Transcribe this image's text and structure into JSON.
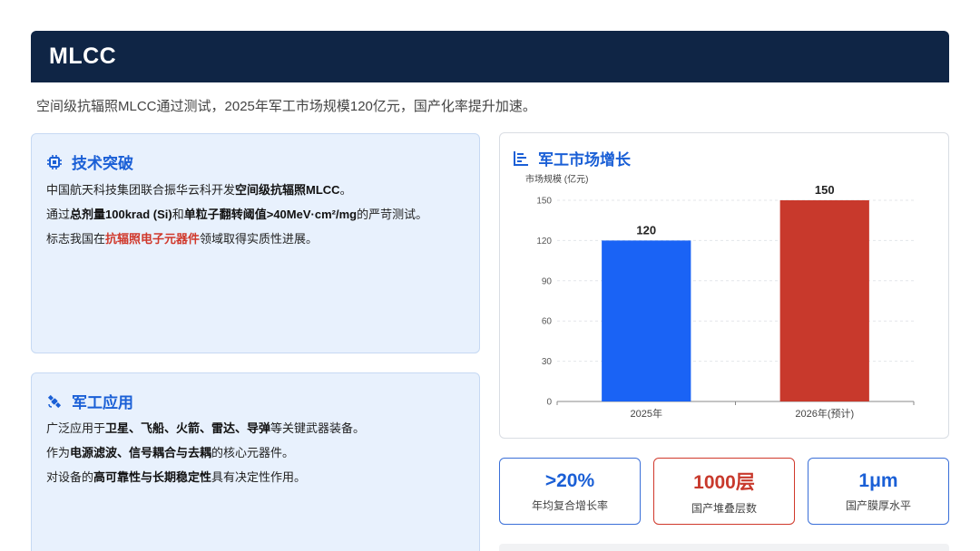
{
  "header": {
    "title": "MLCC"
  },
  "subtitle": "空间级抗辐照MLCC通过测试，2025年军工市场规模120亿元，国产化率提升加速。",
  "tech_card": {
    "title": "技术突破",
    "icon": "chip-icon",
    "line1": {
      "pre": "中国航天科技集团联合振华云科开发",
      "bold": "空间级抗辐照MLCC",
      "post": "。"
    },
    "line2": {
      "pre": "通过",
      "bold1": "总剂量100krad (Si)",
      "mid": "和",
      "bold2": "单粒子翻转阈值>40MeV·cm²/mg",
      "post": "的严苛测试。"
    },
    "line3": {
      "pre": "标志我国在",
      "red": "抗辐照电子元器件",
      "post": "领域取得实质性进展。"
    }
  },
  "mil_card": {
    "title": "军工应用",
    "icon": "satellite-icon",
    "line1": {
      "pre": "广泛应用于",
      "bold": "卫星、飞船、火箭、雷达、导弹",
      "post": "等关键武器装备。"
    },
    "line2": {
      "pre": "作为",
      "bold": "电源滤波、信号耦合与去耦",
      "post": "的核心元器件。"
    },
    "line3": {
      "pre": "对设备的",
      "bold": "高可靠性与长期稳定性",
      "post": "具有决定性作用。"
    }
  },
  "chart_card": {
    "title": "军工市场增长",
    "icon": "bar-chart-icon"
  },
  "chart_data": {
    "type": "bar",
    "ylabel": "市场规模 (亿元)",
    "categories": [
      "2025年",
      "2026年(预计)"
    ],
    "values": [
      120,
      150
    ],
    "bar_colors": [
      "#1a63f5",
      "#c8392c"
    ],
    "ylim": [
      0,
      150
    ],
    "yticks": [
      "0",
      "30",
      "60",
      "90",
      "120",
      "150"
    ],
    "grid": true
  },
  "stats": [
    {
      "value": ">20%",
      "label": "年均复合增长率"
    },
    {
      "value": "1000层",
      "label": "国产堆叠层数"
    },
    {
      "value": "1μm",
      "label": "国产膜厚水平"
    }
  ],
  "colors": {
    "header_bg": "#0f2545",
    "accent_blue": "#1a5fd6",
    "accent_red": "#c8392c",
    "card_bg": "#e8f1fd"
  }
}
